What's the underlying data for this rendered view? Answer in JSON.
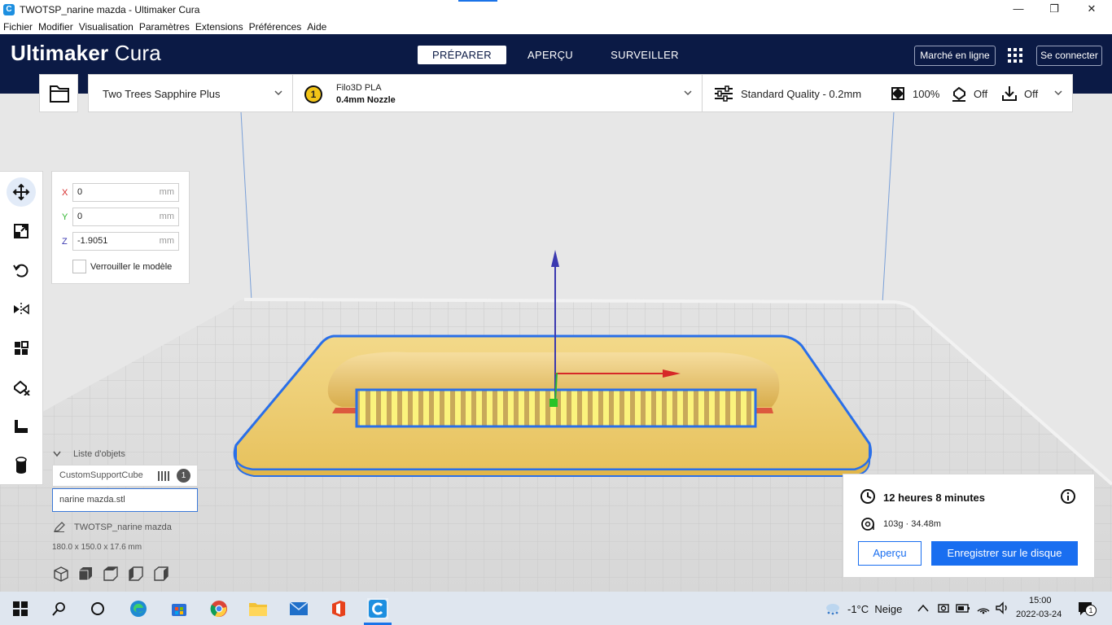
{
  "window": {
    "title": "TWOTSP_narine mazda - Ultimaker Cura",
    "minimize": "—",
    "maximize": "❐",
    "close": "✕"
  },
  "menu": [
    "Fichier",
    "Modifier",
    "Visualisation",
    "Paramètres",
    "Extensions",
    "Préférences",
    "Aide"
  ],
  "header": {
    "logo_bold": "Ultimaker",
    "logo_light": " Cura",
    "tabs": [
      "PRÉPARER",
      "APERÇU",
      "SURVEILLER"
    ],
    "active_tab": "PRÉPARER",
    "marketplace": "Marché en ligne",
    "signin": "Se connecter"
  },
  "toolbar": {
    "printer": "Two Trees Sapphire Plus",
    "extruder_number": "1",
    "material": "Filo3D PLA",
    "nozzle": "0.4mm Nozzle",
    "quality": "Standard Quality - 0.2mm",
    "infill": "100%",
    "support": "Off",
    "adhesion": "Off"
  },
  "move_panel": {
    "x_label": "X",
    "x_value": "0",
    "y_label": "Y",
    "y_value": "0",
    "z_label": "Z",
    "z_value": "-1.9051",
    "unit": "mm",
    "lock_label": "Verrouiller le modèle"
  },
  "objects": {
    "header": "Liste d'objets",
    "items": [
      {
        "name": "CustomSupportCube",
        "badge": "1"
      },
      {
        "name": "narine mazda.stl"
      }
    ],
    "project_name": "TWOTSP_narine mazda",
    "dimensions": "180.0 x 150.0 x 17.6 mm"
  },
  "print_info": {
    "time": "12 heures 8 minutes",
    "material": "103g · 34.48m",
    "preview_btn": "Aperçu",
    "save_btn": "Enregistrer sur le disque"
  },
  "taskbar": {
    "weather": "-1°C  Neige",
    "time": "15:00",
    "date": "2022-03-24",
    "notif_count": "1"
  },
  "colors": {
    "header_bg": "#0b1a45",
    "accent_blue": "#196ef0",
    "model_yellow": "#f4d479",
    "selection_blue": "#2a6fe8"
  }
}
